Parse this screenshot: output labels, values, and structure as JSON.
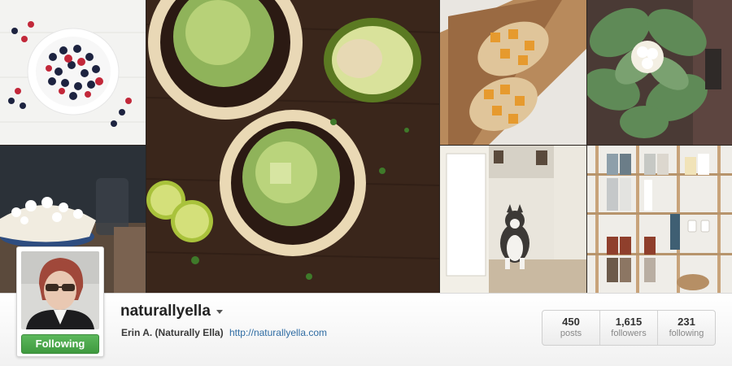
{
  "profile": {
    "username": "naturallyella",
    "full_name": "Erin A. (Naturally Ella)",
    "website": "http://naturallyella.com",
    "follow_label": "Following"
  },
  "stats": [
    {
      "value": "450",
      "label": "posts"
    },
    {
      "value": "1,615",
      "label": "followers"
    },
    {
      "value": "231",
      "label": "following"
    }
  ],
  "colors": {
    "follow_button": "#4caa4c",
    "link": "#2f6ca3"
  },
  "icons": {
    "dropdown": "chevron-down-icon"
  }
}
